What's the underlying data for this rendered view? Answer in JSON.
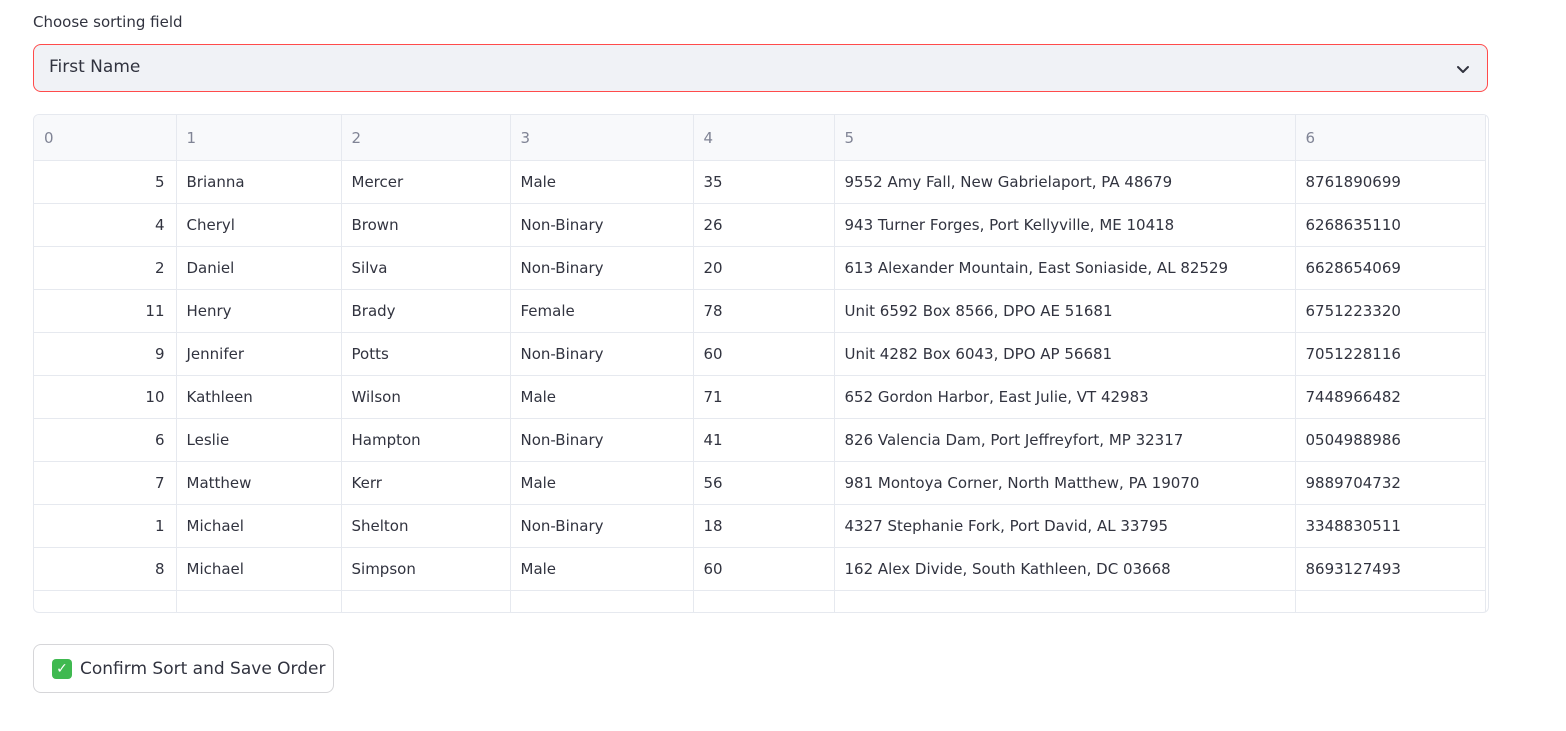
{
  "sort_select": {
    "label": "Choose sorting field",
    "value": "First Name",
    "icon": "chevron-down-icon"
  },
  "table": {
    "columns": [
      "0",
      "1",
      "2",
      "3",
      "4",
      "5",
      "6"
    ],
    "rows": [
      [
        "5",
        "Brianna",
        "Mercer",
        "Male",
        "35",
        "9552 Amy Fall, New Gabrielaport, PA 48679",
        "8761890699"
      ],
      [
        "4",
        "Cheryl",
        "Brown",
        "Non-Binary",
        "26",
        "943 Turner Forges, Port Kellyville, ME 10418",
        "6268635110"
      ],
      [
        "2",
        "Daniel",
        "Silva",
        "Non-Binary",
        "20",
        "613 Alexander Mountain, East Soniaside, AL 82529",
        "6628654069"
      ],
      [
        "11",
        "Henry",
        "Brady",
        "Female",
        "78",
        "Unit 6592 Box 8566, DPO AE 51681",
        "6751223320"
      ],
      [
        "9",
        "Jennifer",
        "Potts",
        "Non-Binary",
        "60",
        "Unit 4282 Box 6043, DPO AP 56681",
        "7051228116"
      ],
      [
        "10",
        "Kathleen",
        "Wilson",
        "Male",
        "71",
        "652 Gordon Harbor, East Julie, VT 42983",
        "7448966482"
      ],
      [
        "6",
        "Leslie",
        "Hampton",
        "Non-Binary",
        "41",
        "826 Valencia Dam, Port Jeffreyfort, MP 32317",
        "0504988986"
      ],
      [
        "7",
        "Matthew",
        "Kerr",
        "Male",
        "56",
        "981 Montoya Corner, North Matthew, PA 19070",
        "9889704732"
      ],
      [
        "1",
        "Michael",
        "Shelton",
        "Non-Binary",
        "18",
        "4327 Stephanie Fork, Port David, AL 33795",
        "3348830511"
      ],
      [
        "8",
        "Michael",
        "Simpson",
        "Male",
        "60",
        "162 Alex Divide, South Kathleen, DC 03668",
        "8693127493"
      ]
    ]
  },
  "confirm_button": {
    "icon": "check-mark-icon",
    "label": "Confirm Sort and Save Order"
  },
  "colors": {
    "select_border": "#ff4b4b",
    "select_bg": "#f0f2f6",
    "header_bg": "#f8f9fb",
    "grid_line": "#e6e9ef",
    "check_green": "#3fb950"
  }
}
